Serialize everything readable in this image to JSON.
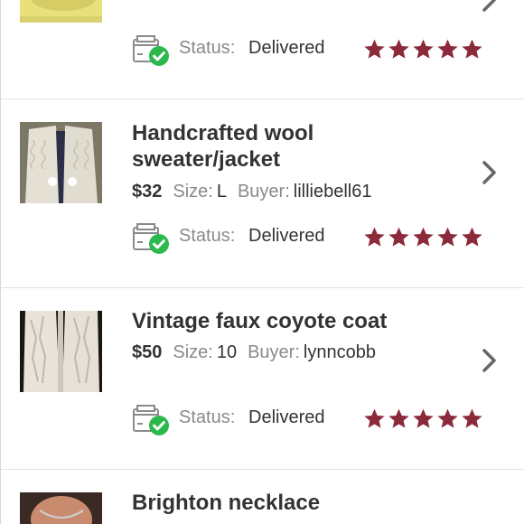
{
  "colors": {
    "star": "#8b2a3a",
    "check_green": "#2db84d",
    "muted": "#8a8a8a",
    "text": "#333333",
    "divider": "#e3e3e3"
  },
  "status_label": "Status:",
  "orders": [
    {
      "status": "Delivered",
      "rating": 5
    },
    {
      "title_line1": "Handcrafted wool",
      "title_line2": "sweater/jacket",
      "price": "$32",
      "size_label": "Size:",
      "size": "L",
      "buyer_label": "Buyer:",
      "buyer": "lilliebell61",
      "status": "Delivered",
      "rating": 5
    },
    {
      "title_line1": "Vintage faux coyote coat",
      "price": "$50",
      "size_label": "Size:",
      "size": "10",
      "buyer_label": "Buyer:",
      "buyer": "lynncobb",
      "status": "Delivered",
      "rating": 5
    },
    {
      "title_line1": "Brighton necklace"
    }
  ]
}
